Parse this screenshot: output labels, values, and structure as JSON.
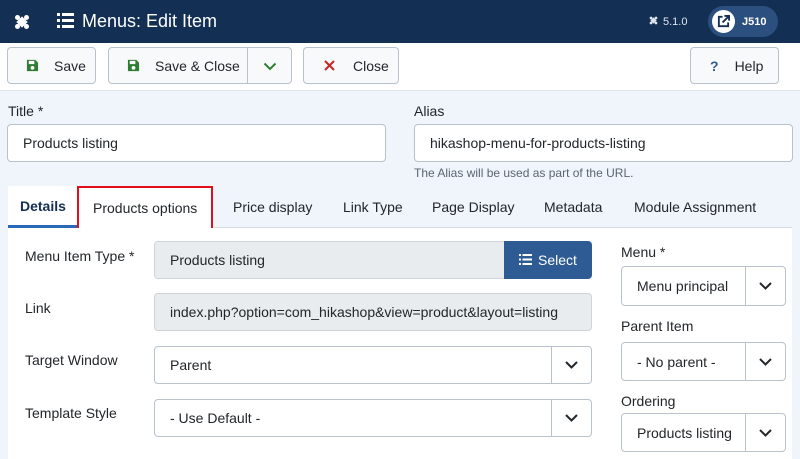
{
  "header": {
    "title": "Menus: Edit Item",
    "version": "5.1.0",
    "user": "J510"
  },
  "toolbar": {
    "save_label": "Save",
    "save_close_label": "Save & Close",
    "close_label": "Close",
    "help_label": "Help"
  },
  "form": {
    "title_label": "Title *",
    "title_value": "Products listing",
    "alias_label": "Alias",
    "alias_value": "hikashop-menu-for-products-listing",
    "alias_hint": "The Alias will be used as part of the URL."
  },
  "tabs": [
    {
      "label": "Details"
    },
    {
      "label": "Products options"
    },
    {
      "label": "Price display"
    },
    {
      "label": "Link Type"
    },
    {
      "label": "Page Display"
    },
    {
      "label": "Metadata"
    },
    {
      "label": "Module Assignment"
    }
  ],
  "details": {
    "menu_item_type_label": "Menu Item Type *",
    "menu_item_type_value": "Products listing",
    "select_button_label": "Select",
    "link_label": "Link",
    "link_value": "index.php?option=com_hikashop&view=product&layout=listing",
    "target_window_label": "Target Window",
    "target_window_value": "Parent",
    "template_style_label": "Template Style",
    "template_style_value": "- Use Default -"
  },
  "sidebar": {
    "menu_label": "Menu *",
    "menu_value": "Menu principal",
    "parent_label": "Parent Item",
    "parent_value": "- No parent -",
    "ordering_label": "Ordering",
    "ordering_value": "Products listing"
  },
  "colors": {
    "header_bg": "#132f53",
    "primary": "#2e5b93",
    "save_icon": "#2f7d32",
    "close_icon": "#c52827",
    "highlight": "#e0101a"
  }
}
